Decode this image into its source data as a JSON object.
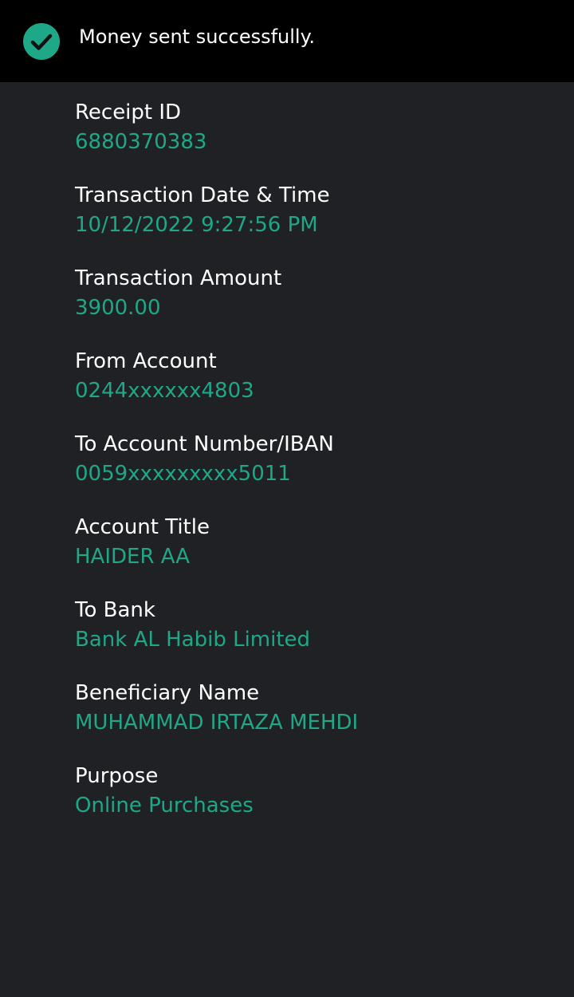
{
  "banner": {
    "message": "Money sent successfully.",
    "icon": "check-circle-icon",
    "icon_color": "#1ea888"
  },
  "colors": {
    "background": "#202124",
    "banner_background": "#000000",
    "label": "#ffffff",
    "value": "#1ea888"
  },
  "receipt": {
    "receipt_id": {
      "label": "Receipt ID",
      "value": "6880370383"
    },
    "date_time": {
      "label": "Transaction Date & Time",
      "value": "10/12/2022 9:27:56 PM"
    },
    "amount": {
      "label": "Transaction Amount",
      "value": "3900.00"
    },
    "from_account": {
      "label": "From Account",
      "value": "0244xxxxxx4803"
    },
    "to_account": {
      "label": "To Account Number/IBAN",
      "value": "0059xxxxxxxxx5011"
    },
    "account_title": {
      "label": "Account Title",
      "value": "HAIDER AA"
    },
    "to_bank": {
      "label": "To Bank",
      "value": "Bank AL Habib Limited"
    },
    "beneficiary": {
      "label": "Beneficiary Name",
      "value": "MUHAMMAD IRTAZA MEHDI"
    },
    "purpose": {
      "label": "Purpose",
      "value": "Online Purchases"
    }
  }
}
